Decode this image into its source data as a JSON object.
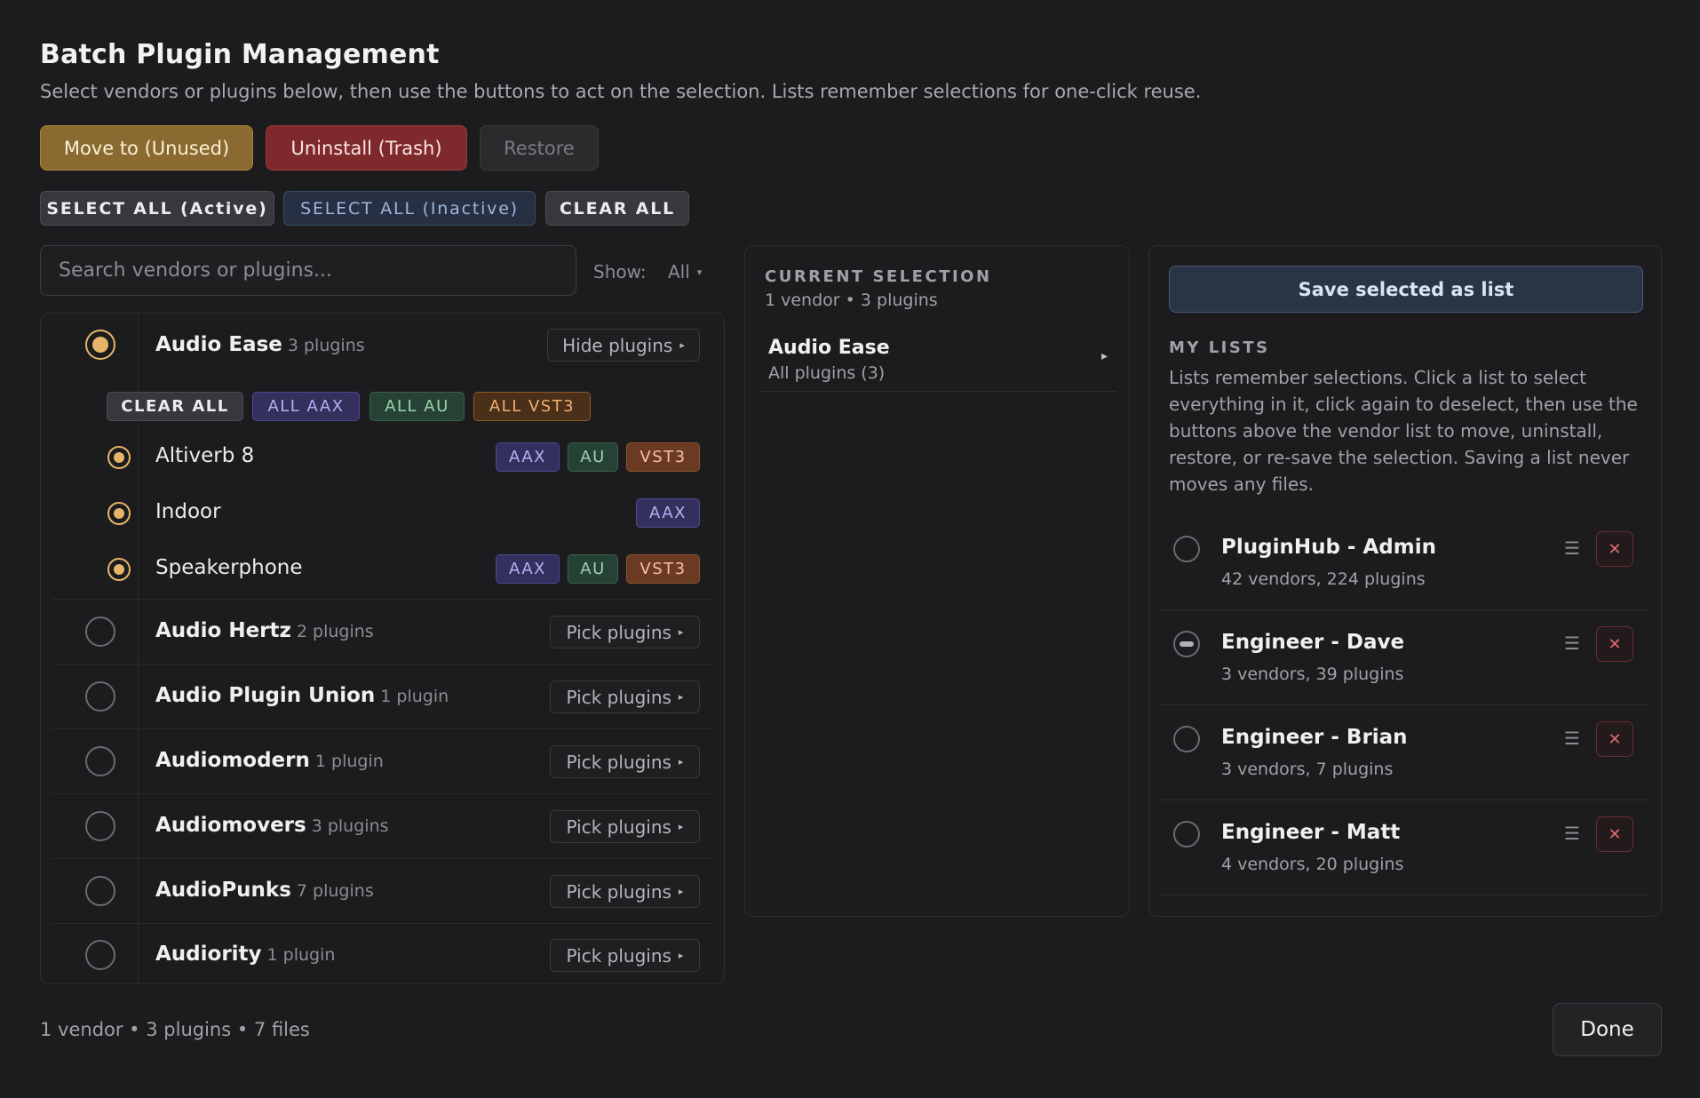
{
  "header": {
    "title": "Batch Plugin Management",
    "subtitle": "Select vendors or plugins below, then use the buttons to act on the selection. Lists remember selections for one-click reuse."
  },
  "actions": {
    "move_label": "Move to (Unused)",
    "uninstall_label": "Uninstall (Trash)",
    "restore_label": "Restore"
  },
  "selection_buttons": {
    "select_active": "SELECT ALL (Active)",
    "select_inactive": "SELECT ALL (Inactive)",
    "clear_all": "CLEAR ALL"
  },
  "search": {
    "placeholder": "Search vendors or plugins...",
    "value": ""
  },
  "filter": {
    "label": "Show:",
    "value": "All"
  },
  "vendors": [
    {
      "name": "Audio Ease",
      "count": "3 plugins",
      "selected": true,
      "toggle_label": "Hide plugins",
      "quick_tags": [
        "CLEAR ALL",
        "ALL AAX",
        "ALL AU",
        "ALL VST3"
      ],
      "plugins": [
        {
          "name": "Altiverb 8",
          "formats": [
            "AAX",
            "AU",
            "VST3"
          ]
        },
        {
          "name": "Indoor",
          "formats": [
            "AAX"
          ]
        },
        {
          "name": "Speakerphone",
          "formats": [
            "AAX",
            "AU",
            "VST3"
          ]
        }
      ]
    },
    {
      "name": "Audio Hertz",
      "count": "2 plugins",
      "toggle_label": "Pick plugins"
    },
    {
      "name": "Audio Plugin Union",
      "count": "1 plugin",
      "toggle_label": "Pick plugins"
    },
    {
      "name": "Audiomodern",
      "count": "1 plugin",
      "toggle_label": "Pick plugins"
    },
    {
      "name": "Audiomovers",
      "count": "3 plugins",
      "toggle_label": "Pick plugins"
    },
    {
      "name": "AudioPunks",
      "count": "7 plugins",
      "toggle_label": "Pick plugins"
    },
    {
      "name": "Audiority",
      "count": "1 plugin",
      "toggle_label": "Pick plugins"
    }
  ],
  "current_selection": {
    "label": "CURRENT SELECTION",
    "summary": "1 vendor • 3 plugins",
    "items": [
      {
        "name": "Audio Ease",
        "detail": "All plugins (3)"
      }
    ]
  },
  "lists": {
    "save_label": "Save selected as list",
    "label": "MY LISTS",
    "description": "Lists remember selections. Click a list to select everything in it, click again to deselect, then use the buttons above the vendor list to move, uninstall, restore, or re-save the selection. Saving a list never moves any files.",
    "items": [
      {
        "name": "PluginHub - Admin",
        "detail": "42 vendors, 224 plugins",
        "state": "none"
      },
      {
        "name": "Engineer - Dave",
        "detail": "3 vendors, 39 plugins",
        "state": "partial"
      },
      {
        "name": "Engineer - Brian",
        "detail": "3 vendors, 7 plugins",
        "state": "none"
      },
      {
        "name": "Engineer - Matt",
        "detail": "4 vendors, 20 plugins",
        "state": "none"
      }
    ]
  },
  "footer": {
    "summary": "1 vendor • 3 plugins • 7 files",
    "done_label": "Done"
  },
  "colors": {
    "background": "#1c1c1e",
    "accent": "#e6b567",
    "move": "#8a6a30",
    "uninstall": "#7e2a2c",
    "aax": "#33305e",
    "au": "#264234",
    "vst3": "#6a3a22"
  }
}
